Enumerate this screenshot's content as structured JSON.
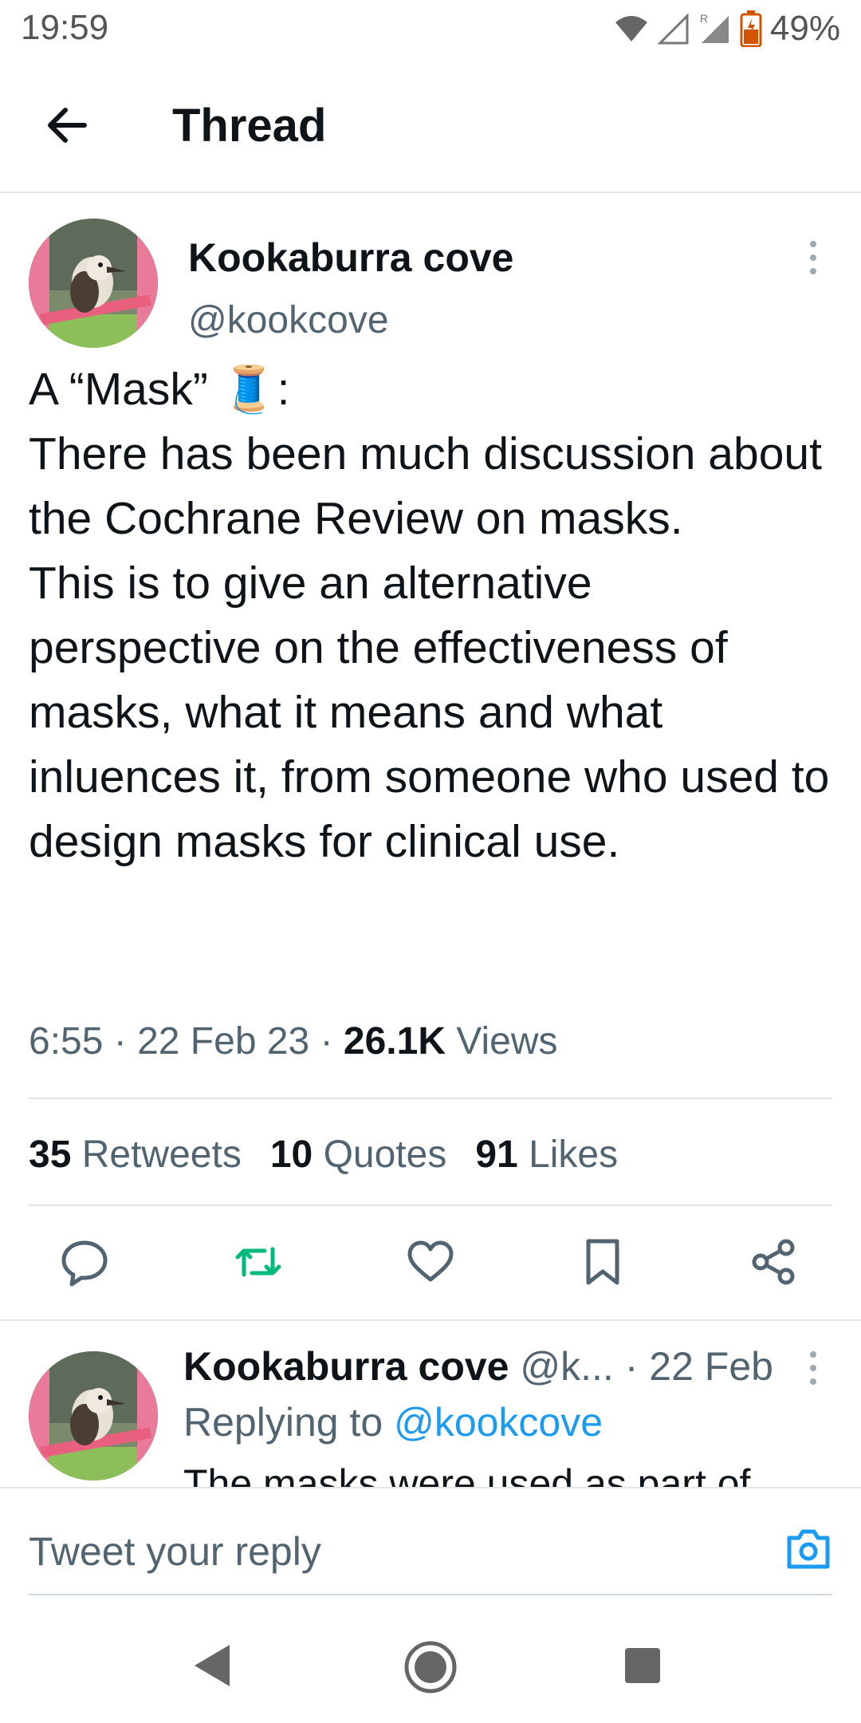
{
  "status_bar": {
    "time": "19:59",
    "battery": "49%"
  },
  "header": {
    "title": "Thread"
  },
  "tweet": {
    "author_name": "Kookaburra cove",
    "author_handle": "@kookcove",
    "text_line1": "A “Mask” 🧵:",
    "text_rest": "There has been much discussion about the Cochrane Review on masks.\nThis is to give an alternative perspective on the effectiveness of masks, what it means and what inluences it, from someone who used to design masks for clinical use.",
    "time": "6:55",
    "date": "22 Feb 23",
    "views_count": "26.1K",
    "views_label": "Views",
    "retweets_count": "35",
    "retweets_label": "Retweets",
    "quotes_count": "10",
    "quotes_label": "Quotes",
    "likes_count": "91",
    "likes_label": "Likes"
  },
  "reply": {
    "author_name": "Kookaburra cove",
    "author_handle_truncated": "@k...",
    "date": "· 22 Feb",
    "replying_label": "Replying to",
    "replying_to": "@kookcove",
    "text_partial": "The masks were used as part of"
  },
  "compose": {
    "placeholder": "Tweet your reply"
  },
  "colors": {
    "accent": "#1d9bf0",
    "retweet_green": "#00ba7c",
    "text": "#0f1419",
    "muted": "#536471"
  },
  "icons": [
    "back-arrow-icon",
    "more-vertical-icon",
    "reply-icon",
    "retweet-icon",
    "like-icon",
    "bookmark-icon",
    "share-icon",
    "camera-icon",
    "nav-back-icon",
    "nav-home-icon",
    "nav-recents-icon"
  ]
}
